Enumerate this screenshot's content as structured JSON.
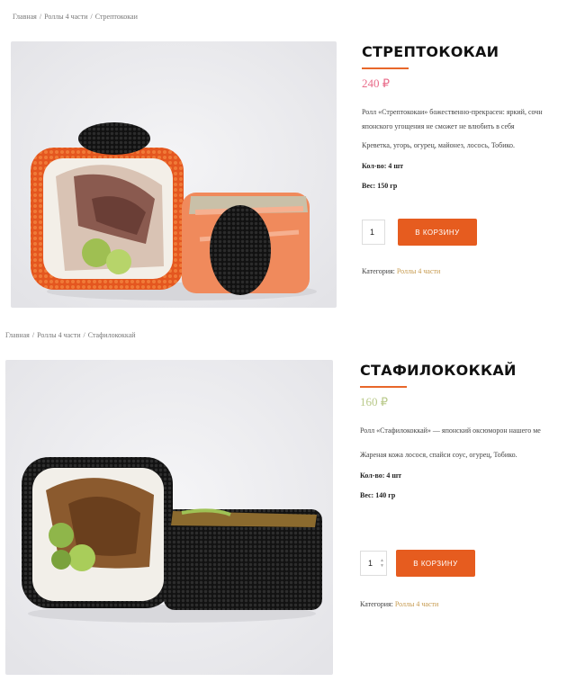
{
  "theme": {
    "accent": "#e8672a",
    "button": "#e65c1f",
    "price_green": "#b9c98a",
    "price_pink": "#e96c8a"
  },
  "products": [
    {
      "breadcrumb": [
        "Главная",
        "Роллы 4 части",
        "Стрептококаи"
      ],
      "title": "СТРЕПТОКОКАИ",
      "price": "240 ₽",
      "description": [
        "Ролл «Стрептококаи» божественно-прекрасен: яркий, сочн",
        "японского угощения не сможет не влюбить в себя"
      ],
      "ingredients": "Креветка, угорь, огурец, майонез, лосось, Тобико.",
      "qty_label": "Кол-во: 4 шт",
      "weight_label": "Вес: 150 гр",
      "quantity": "1",
      "cart_button": "В КОРЗИНУ",
      "category_label": "Категория:",
      "category_link": "Роллы 4 части",
      "image_icon": "sushi-roll-salmon-image"
    },
    {
      "breadcrumb": [
        "Главная",
        "Роллы 4 части",
        "Стафилококкай"
      ],
      "title": "СТАФИЛОКОККАЙ",
      "price": "160 ₽",
      "description": [
        "Ролл «Стафилококкай» — японский оксюморон нашего ме"
      ],
      "ingredients": "Жареная кожа лосося, спайси соус, огурец, Тобико.",
      "qty_label": "Кол-во: 4 шт",
      "weight_label": "Вес: 140 гр",
      "quantity": "1",
      "cart_button": "В КОРЗИНУ",
      "category_label": "Категория:",
      "category_link": "Роллы 4 части",
      "image_icon": "sushi-roll-black-tobiko-image"
    }
  ]
}
